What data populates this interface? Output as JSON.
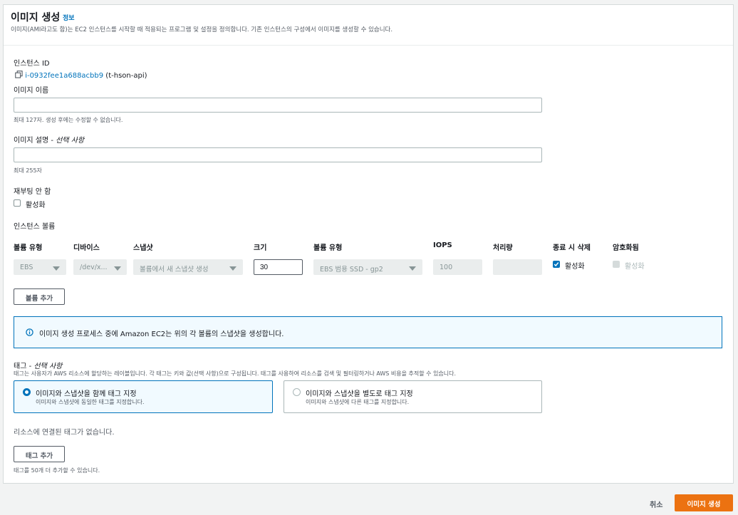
{
  "header": {
    "title": "이미지 생성",
    "info_link": "정보",
    "description": "이미지(AMI라고도 함)는 EC2 인스턴스를 시작할 때 적용되는 프로그램 및 설정을 정의합니다. 기존 인스턴스의 구성에서 이미지를 생성할 수 있습니다."
  },
  "instance": {
    "label": "인스턴스 ID",
    "id": "i-0932fee1a688acbb9",
    "name": "(t-hson-api)"
  },
  "image_name": {
    "label": "이미지 이름",
    "value": "",
    "hint": "최대 127자. 생성 후에는 수정할 수 없습니다."
  },
  "image_desc": {
    "label": "이미지 설명 - ",
    "optional": "선택 사항",
    "value": "",
    "hint": "최대 255자"
  },
  "no_reboot": {
    "label": "재부팅 안 함",
    "checkbox_label": "활성화",
    "checked": false
  },
  "volumes": {
    "section_label": "인스턴스 볼륨",
    "headers": {
      "volume_type": "볼륨 유형",
      "device": "디바이스",
      "snapshot": "스냅샷",
      "size": "크기",
      "ebs_type": "볼륨 유형",
      "iops": "IOPS",
      "throughput": "처리량",
      "delete_on_term": "종료 시 삭제",
      "encrypted": "암호화됨"
    },
    "row": {
      "volume_type": "EBS",
      "device": "/dev/x...",
      "snapshot": "볼륨에서 새 스냅샷 생성",
      "size": "30",
      "ebs_type": "EBS 범용 SSD - gp2",
      "iops": "100",
      "throughput": "",
      "delete_on_term_label": "활성화",
      "delete_on_term": true,
      "encrypted_label": "활성화",
      "encrypted": false
    },
    "add_button": "볼륨 추가"
  },
  "alert": {
    "text": "이미지 생성 프로세스 중에 Amazon EC2는 위의 각 볼륨의 스냅샷을 생성합니다."
  },
  "tags": {
    "label": "태그 - ",
    "optional": "선택 사항",
    "description": "태그는 사용자가 AWS 리소스에 할당하는 레이블입니다. 각 태그는 키와 값(선택 사항)으로 구성됩니다. 태그를 사용하여 리소스를 검색 및 필터링하거나 AWS 비용을 추적할 수 있습니다.",
    "option_together": {
      "title": "이미지와 스냅샷을 함께 태그 지정",
      "desc": "이미지와 스냅샷에 동일한 태그를 지정합니다.",
      "selected": true
    },
    "option_separate": {
      "title": "이미지와 스냅샷을 별도로 태그 지정",
      "desc": "이미지와 스냅샷에 다른 태그를 지정합니다.",
      "selected": false
    },
    "empty_text": "리소스에 연결된 태그가 없습니다.",
    "add_button": "태그 추가",
    "hint": "태그를 50개 더 추가할 수 있습니다."
  },
  "footer": {
    "cancel": "취소",
    "submit": "이미지 생성"
  },
  "colors": {
    "accent": "#0073bb",
    "primary_button": "#ec7211",
    "border": "#aab7b8"
  }
}
